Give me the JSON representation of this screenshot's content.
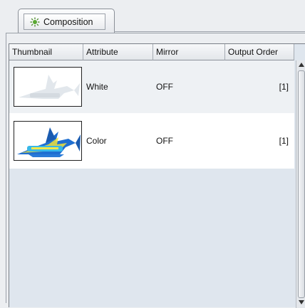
{
  "tab": {
    "label": "Composition",
    "icon": "composition-icon"
  },
  "table": {
    "columns": [
      "Thumbnail",
      "Attribute",
      "Mirror",
      "Output Order"
    ],
    "rows": [
      {
        "thumbnail": "white-marlin-thumbnail",
        "attribute": "White",
        "mirror": "OFF",
        "output_order": "[1]"
      },
      {
        "thumbnail": "color-marlin-thumbnail",
        "attribute": "Color",
        "mirror": "OFF",
        "output_order": "[1]"
      }
    ]
  },
  "colors": {
    "selected_row": "#eef1f4",
    "white_row": "#ffffff",
    "empty_area": "#dfe6ee"
  }
}
